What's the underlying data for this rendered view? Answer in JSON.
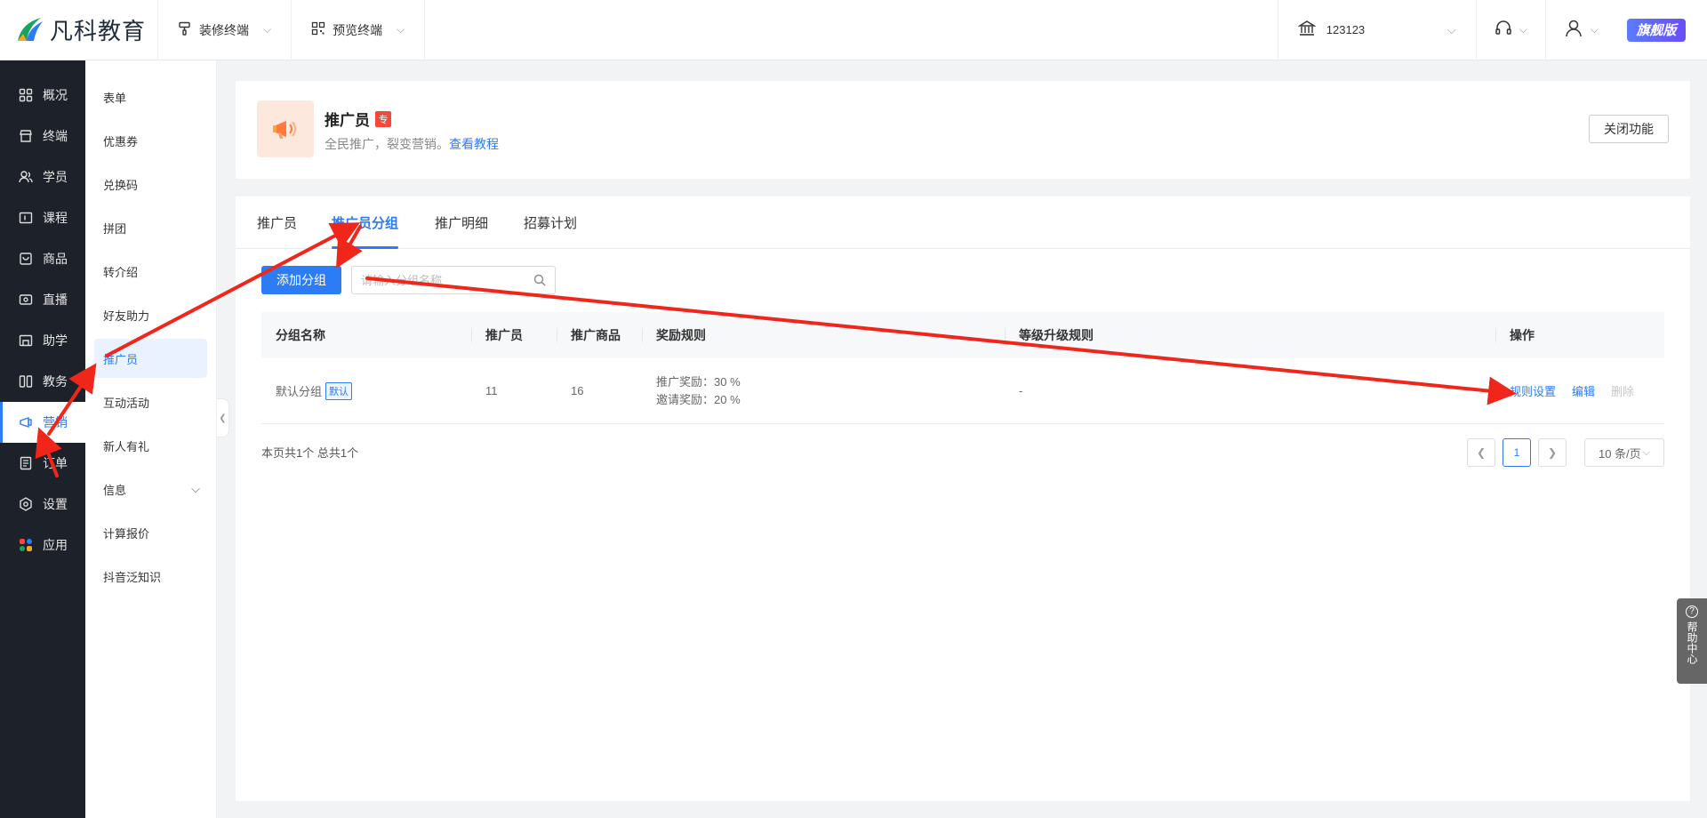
{
  "header": {
    "logo_text": "凡科教育",
    "decorate": "装修终端",
    "preview": "预览终端",
    "store": "123123",
    "vip": "旗舰版"
  },
  "main_nav": [
    {
      "label": "概况",
      "icon": "grid-icon"
    },
    {
      "label": "终端",
      "icon": "store-icon"
    },
    {
      "label": "学员",
      "icon": "users-icon"
    },
    {
      "label": "课程",
      "icon": "course-icon"
    },
    {
      "label": "商品",
      "icon": "bag-icon"
    },
    {
      "label": "直播",
      "icon": "live-icon"
    },
    {
      "label": "助学",
      "icon": "study-icon"
    },
    {
      "label": "教务",
      "icon": "book-icon"
    },
    {
      "label": "营销",
      "icon": "marketing-icon",
      "active": true
    },
    {
      "label": "订单",
      "icon": "order-icon"
    },
    {
      "label": "设置",
      "icon": "gear-icon"
    },
    {
      "label": "应用",
      "icon": "apps-icon"
    }
  ],
  "sub_nav": [
    {
      "label": "表单"
    },
    {
      "label": "优惠券"
    },
    {
      "label": "兑换码"
    },
    {
      "label": "拼团"
    },
    {
      "label": "转介绍"
    },
    {
      "label": "好友助力"
    },
    {
      "label": "推广员",
      "active": true
    },
    {
      "label": "互动活动"
    },
    {
      "label": "新人有礼"
    },
    {
      "label": "信息",
      "has_children": true
    },
    {
      "label": "计算报价"
    },
    {
      "label": "抖音泛知识"
    }
  ],
  "feature": {
    "title": "推广员",
    "badge": "专",
    "desc": "全民推广，裂变营销。",
    "tutorial_link": "查看教程",
    "close_button": "关闭功能"
  },
  "tabs": [
    {
      "label": "推广员"
    },
    {
      "label": "推广员分组",
      "active": true
    },
    {
      "label": "推广明细"
    },
    {
      "label": "招募计划"
    }
  ],
  "toolbar": {
    "add_button": "添加分组",
    "search_placeholder": "请输入分组名称"
  },
  "table": {
    "headers": [
      "分组名称",
      "推广员",
      "推广商品",
      "奖励规则",
      "等级升级规则",
      "操作"
    ],
    "rows": [
      {
        "name": "默认分组",
        "tag": "默认",
        "promoters": "11",
        "products": "16",
        "reward_1": "推广奖励：30 %",
        "reward_2": "邀请奖励：20 %",
        "upgrade_rule": "-",
        "actions": [
          "规则设置",
          "编辑",
          "删除"
        ]
      }
    ]
  },
  "pagination": {
    "summary": "本页共1个 总共1个",
    "current_page": "1",
    "page_size": "10 条/页"
  },
  "help": {
    "label": "帮助中心"
  },
  "colors": {
    "accent": "#2c7cf6",
    "sidebar_dark": "#1d2129",
    "annotation_arrow": "#f0261b"
  }
}
